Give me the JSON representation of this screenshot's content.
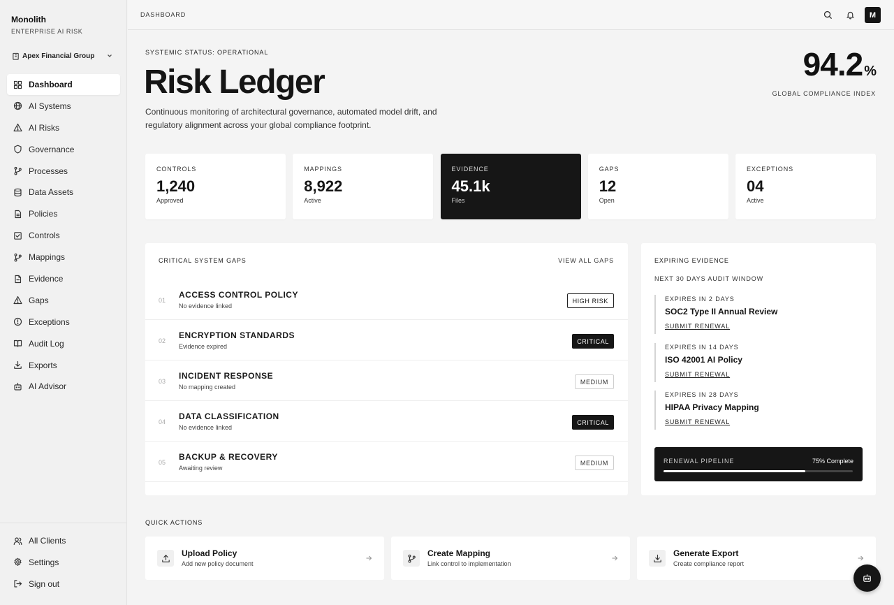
{
  "brand": {
    "name": "Monolith",
    "subtitle": "ENTERPRISE AI RISK"
  },
  "org": {
    "name": "Apex Financial Group"
  },
  "nav": [
    {
      "label": "Dashboard",
      "icon": "grid-icon",
      "active": true
    },
    {
      "label": "AI Systems",
      "icon": "globe-icon"
    },
    {
      "label": "AI Risks",
      "icon": "warning-icon"
    },
    {
      "label": "Governance",
      "icon": "shield-icon"
    },
    {
      "label": "Processes",
      "icon": "branch-icon"
    },
    {
      "label": "Data Assets",
      "icon": "database-icon"
    },
    {
      "label": "Policies",
      "icon": "document-icon"
    },
    {
      "label": "Controls",
      "icon": "checkbox-icon"
    },
    {
      "label": "Mappings",
      "icon": "branch-icon"
    },
    {
      "label": "Evidence",
      "icon": "file-icon"
    },
    {
      "label": "Gaps",
      "icon": "warning-icon"
    },
    {
      "label": "Exceptions",
      "icon": "alert-circle-icon"
    },
    {
      "label": "Audit Log",
      "icon": "book-icon"
    },
    {
      "label": "Exports",
      "icon": "download-icon"
    },
    {
      "label": "AI Advisor",
      "icon": "robot-icon"
    }
  ],
  "bottom_nav": [
    {
      "label": "All Clients",
      "icon": "users-icon"
    },
    {
      "label": "Settings",
      "icon": "gear-icon"
    },
    {
      "label": "Sign out",
      "icon": "sign-out-icon"
    }
  ],
  "topbar": {
    "breadcrumb": "DASHBOARD",
    "avatar": "M"
  },
  "hero": {
    "status": "SYSTEMIC STATUS: OPERATIONAL",
    "title": "Risk Ledger",
    "description": "Continuous monitoring of architectural governance, automated model drift, and regulatory alignment across your global compliance footprint.",
    "index_value": "94.2",
    "index_unit": "%",
    "index_label": "GLOBAL COMPLIANCE INDEX"
  },
  "stats": [
    {
      "label": "CONTROLS",
      "value": "1,240",
      "sub": "Approved"
    },
    {
      "label": "MAPPINGS",
      "value": "8,922",
      "sub": "Active"
    },
    {
      "label": "EVIDENCE",
      "value": "45.1k",
      "sub": "Files",
      "dark": true
    },
    {
      "label": "GAPS",
      "value": "12",
      "sub": "Open"
    },
    {
      "label": "EXCEPTIONS",
      "value": "04",
      "sub": "Active"
    }
  ],
  "gaps": {
    "title": "CRITICAL SYSTEM GAPS",
    "view_all": "VIEW ALL GAPS",
    "rows": [
      {
        "num": "01",
        "name": "ACCESS CONTROL POLICY",
        "sub": "No evidence linked",
        "badge": "HIGH RISK",
        "style": "outline"
      },
      {
        "num": "02",
        "name": "ENCRYPTION STANDARDS",
        "sub": "Evidence expired",
        "badge": "CRITICAL",
        "style": "solid"
      },
      {
        "num": "03",
        "name": "INCIDENT RESPONSE",
        "sub": "No mapping created",
        "badge": "MEDIUM",
        "style": "light"
      },
      {
        "num": "04",
        "name": "DATA CLASSIFICATION",
        "sub": "No evidence linked",
        "badge": "CRITICAL",
        "style": "solid"
      },
      {
        "num": "05",
        "name": "BACKUP & RECOVERY",
        "sub": "Awaiting review",
        "badge": "MEDIUM",
        "style": "light"
      }
    ]
  },
  "expiring": {
    "title": "EXPIRING EVIDENCE",
    "subtitle": "NEXT 30 DAYS AUDIT WINDOW",
    "items": [
      {
        "when": "EXPIRES IN 2 DAYS",
        "name": "SOC2 Type II Annual Review",
        "action": "SUBMIT RENEWAL"
      },
      {
        "when": "EXPIRES IN 14 DAYS",
        "name": "ISO 42001 AI Policy",
        "action": "SUBMIT RENEWAL"
      },
      {
        "when": "EXPIRES IN 28 DAYS",
        "name": "HIPAA Privacy Mapping",
        "action": "SUBMIT RENEWAL"
      }
    ],
    "pipeline": {
      "label": "RENEWAL PIPELINE",
      "value_text": "75% Complete",
      "progress": 0.75
    }
  },
  "quick_actions": {
    "title": "QUICK ACTIONS",
    "items": [
      {
        "title": "Upload Policy",
        "sub": "Add new policy document",
        "icon": "upload-icon"
      },
      {
        "title": "Create Mapping",
        "sub": "Link control to implementation",
        "icon": "branch-icon"
      },
      {
        "title": "Generate Export",
        "sub": "Create compliance report",
        "icon": "download-icon"
      }
    ]
  }
}
